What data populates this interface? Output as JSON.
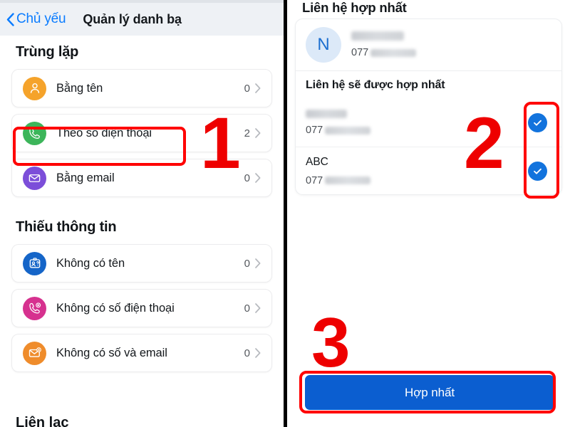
{
  "left_panel": {
    "navbar": {
      "back_label": "Chủ yếu",
      "back_icon": "chevron-left-icon",
      "title": "Quản lý danh bạ"
    },
    "sections": [
      {
        "title": "Trùng lặp",
        "items": [
          {
            "icon": "person-icon",
            "icon_color": "#f5a32b",
            "label": "Bằng tên",
            "count": "0",
            "chevron": "chevron-right-icon"
          },
          {
            "icon": "phone-icon",
            "icon_color": "#3cb55a",
            "label": "Theo số điện thoại",
            "count": "2",
            "chevron": "chevron-right-icon"
          },
          {
            "icon": "envelope-icon",
            "icon_color": "#7c4ed9",
            "label": "Bằng email",
            "count": "0",
            "chevron": "chevron-right-icon"
          }
        ]
      },
      {
        "title": "Thiếu thông tin",
        "items": [
          {
            "icon": "id-card-question-icon",
            "icon_color": "#1565c8",
            "label": "Không có tên",
            "count": "0",
            "chevron": "chevron-right-icon"
          },
          {
            "icon": "phone-missing-icon",
            "icon_color": "#d6318f",
            "label": "Không có số điện thoại",
            "count": "0",
            "chevron": "chevron-right-icon"
          },
          {
            "icon": "envelope-missing-icon",
            "icon_color": "#ef8c2b",
            "label": "Không có số và email",
            "count": "0",
            "chevron": "chevron-right-icon"
          }
        ]
      }
    ],
    "cut_off_section_title": "Liên lạc"
  },
  "right_panel": {
    "heading": "Liên hệ hợp nhất",
    "primary_contact": {
      "avatar_initial": "N",
      "name_redacted": true,
      "phone_prefix": "077",
      "phone_redacted": true
    },
    "sub_heading": "Liên hệ sẽ được hợp nhất",
    "contacts": [
      {
        "name": "",
        "name_redacted": true,
        "phone_prefix": "077",
        "phone_redacted": true,
        "selected": true,
        "check_icon": "check-circle-icon"
      },
      {
        "name": "ABC",
        "name_redacted": false,
        "phone_prefix": "077",
        "phone_redacted": true,
        "selected": true,
        "check_icon": "check-circle-icon"
      }
    ],
    "merge_button_label": "Hợp nhất"
  },
  "annotations": {
    "steps": [
      {
        "number": "1",
        "target": "theo-so-dien-thoai-row"
      },
      {
        "number": "2",
        "target": "contact-checkmarks"
      },
      {
        "number": "3",
        "target": "merge-button"
      }
    ],
    "highlight_color": "#ff0000"
  },
  "colors": {
    "accent_blue": "#0a7cff",
    "button_blue": "#0b5ed0",
    "check_blue": "#1273dd",
    "navbar_bg": "#eef1f5",
    "annotation_red": "#ee0000"
  }
}
